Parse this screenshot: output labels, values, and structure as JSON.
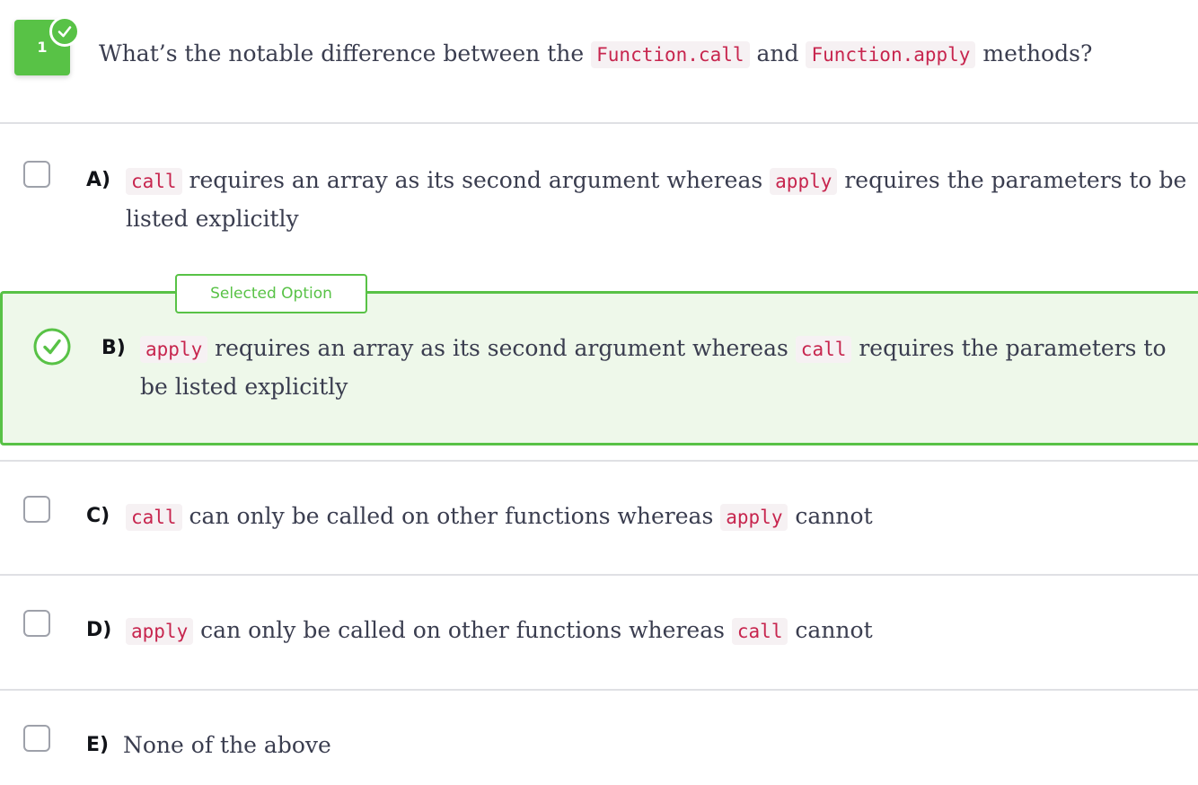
{
  "question": {
    "number": "1",
    "text_before": "What’s the notable difference between the",
    "code1": "Function.call",
    "text_mid": "and",
    "code2": "Function.apply",
    "text_after": "methods?"
  },
  "selected_tag": "Selected Option",
  "options": {
    "a": {
      "letter": "A)",
      "code1": "call",
      "text1": "requires an array as its second argument whereas",
      "code2": "apply",
      "text2": "requires the parameters to be",
      "text3": "listed explicitly"
    },
    "b": {
      "letter": "B)",
      "code1": "apply",
      "text1": "requires an array as its second argument whereas",
      "code2": "call",
      "text2": "requires the parameters to",
      "text3": "be listed explicitly"
    },
    "c": {
      "letter": "C)",
      "code1": "call",
      "text1": "can only be called on other functions whereas",
      "code2": "apply",
      "text2": "cannot"
    },
    "d": {
      "letter": "D)",
      "code1": "apply",
      "text1": "can only be called on other functions whereas",
      "code2": "call",
      "text2": "cannot"
    },
    "e": {
      "letter": "E)",
      "text1": "None of the above"
    }
  },
  "colors": {
    "accent_green": "#58c246",
    "selected_bg": "#eef8ea",
    "code_text": "#c7254e",
    "code_bg": "#f6f1f3",
    "body_text": "#3a3d4f"
  }
}
